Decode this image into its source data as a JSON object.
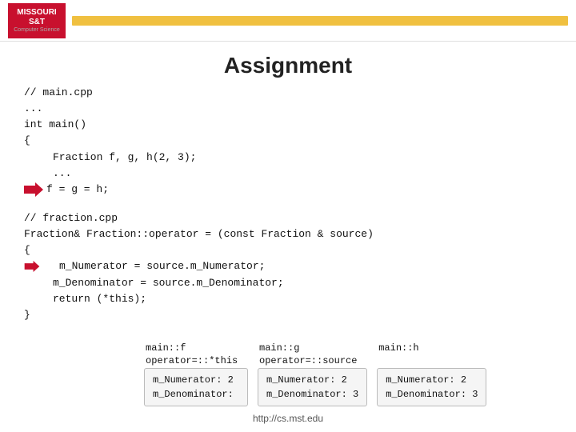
{
  "header": {
    "logo_line1": "MISSOURI",
    "logo_line2": "S&T",
    "logo_subtitle": "Computer Science",
    "bar_color": "#f0c040"
  },
  "title": "Assignment",
  "main_cpp": {
    "comment": "// main.cpp",
    "ellipsis1": "...",
    "int_main": "int main()",
    "brace_open": "{",
    "fraction_line": "    Fraction f, g, h(2, 3);",
    "ellipsis2": "    ...",
    "assign_line": "f = g = h;",
    "brace_close": "}"
  },
  "fraction_cpp": {
    "comment": "// fraction.cpp",
    "signature": "Fraction& Fraction::operator = (const Fraction & source)",
    "brace_open": "{",
    "line1": "m_Numerator = source.m_Numerator;",
    "line2": "m_Denominator = source.m_Denominator;",
    "return_line": "return (*this);",
    "brace_close": "}"
  },
  "tooltips": {
    "f": {
      "label_line1": "main::f",
      "label_line2": "operator=::*this",
      "num": "m_Numerator: 2",
      "den": "m_Denominator:"
    },
    "g": {
      "label_line1": "main::g",
      "label_line2": "operator=::source",
      "num": "m_Numerator: 2",
      "den": "m_Denominator: 3"
    },
    "h": {
      "label_line1": "main::h",
      "label_line2": "",
      "num": "m_Numerator: 2",
      "den": "m_Denominator: 3"
    }
  },
  "footer": {
    "url": "http://cs.mst.edu"
  }
}
